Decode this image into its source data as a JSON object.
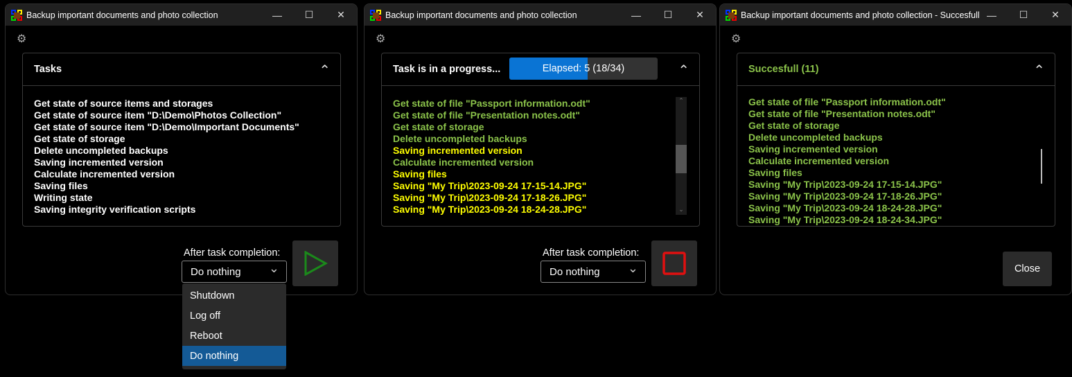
{
  "colors": {
    "pending": "#ffffff",
    "done": "#8bc34a",
    "active": "#ffff00",
    "accent": "#0a74d4",
    "start": "#1b8a1b",
    "stop": "#e01010"
  },
  "windows": [
    {
      "title": "Backup important documents and photo collection",
      "panel_title": "Tasks",
      "panel_title_status": "pending",
      "items": [
        {
          "text": "Get state of source items and storages",
          "status": "pending"
        },
        {
          "text": "Get state of source item \"D:\\Demo\\Photos Collection\"",
          "status": "pending"
        },
        {
          "text": "Get state of source item \"D:\\Demo\\Important Documents\"",
          "status": "pending"
        },
        {
          "text": "Get state of storage",
          "status": "pending"
        },
        {
          "text": "Delete uncompleted backups",
          "status": "pending"
        },
        {
          "text": "Saving incremented version",
          "status": "pending"
        },
        {
          "text": "Calculate incremented version",
          "status": "pending"
        },
        {
          "text": "Saving files",
          "status": "pending"
        },
        {
          "text": "Writing state",
          "status": "pending"
        },
        {
          "text": "Saving integrity verification scripts",
          "status": "pending"
        }
      ],
      "after_label": "After task completion:",
      "after_value": "Do nothing",
      "action": "start-icon",
      "dropdown_options": [
        "Shutdown",
        "Log off",
        "Reboot",
        "Do nothing"
      ],
      "dropdown_selected": "Do nothing"
    },
    {
      "title": "Backup important documents and photo collection",
      "panel_title": "Task is in a progress...",
      "panel_title_status": "pending",
      "progress": {
        "text": "Elapsed: 5 (18/34)",
        "done": 18,
        "total": 34
      },
      "items": [
        {
          "text": "Get state of file \"Passport information.odt\"",
          "status": "done"
        },
        {
          "text": "Get state of file \"Presentation notes.odt\"",
          "status": "done"
        },
        {
          "text": "Get state of storage",
          "status": "done"
        },
        {
          "text": "Delete uncompleted backups",
          "status": "done"
        },
        {
          "text": "Saving incremented version",
          "status": "active"
        },
        {
          "text": "Calculate incremented version",
          "status": "done"
        },
        {
          "text": "Saving files",
          "status": "active"
        },
        {
          "text": "Saving \"My Trip\\2023-09-24 17-15-14.JPG\"",
          "status": "active"
        },
        {
          "text": "Saving \"My Trip\\2023-09-24 17-18-26.JPG\"",
          "status": "active"
        },
        {
          "text": "Saving \"My Trip\\2023-09-24 18-24-28.JPG\"",
          "status": "active"
        }
      ],
      "after_label": "After task completion:",
      "after_value": "Do nothing",
      "action": "stop-icon"
    },
    {
      "title": "Backup important documents and photo collection - Succesfull",
      "panel_title": "Succesfull (11)",
      "panel_title_status": "done",
      "items": [
        {
          "text": "Get state of file \"Passport information.odt\"",
          "status": "done"
        },
        {
          "text": "Get state of file \"Presentation notes.odt\"",
          "status": "done"
        },
        {
          "text": "Get state of storage",
          "status": "done"
        },
        {
          "text": "Delete uncompleted backups",
          "status": "done"
        },
        {
          "text": "Saving incremented version",
          "status": "done"
        },
        {
          "text": "Calculate incremented version",
          "status": "done"
        },
        {
          "text": "Saving files",
          "status": "done"
        },
        {
          "text": "Saving \"My Trip\\2023-09-24 17-15-14.JPG\"",
          "status": "done"
        },
        {
          "text": "Saving \"My Trip\\2023-09-24 17-18-26.JPG\"",
          "status": "done"
        },
        {
          "text": "Saving \"My Trip\\2023-09-24 18-24-28.JPG\"",
          "status": "done"
        },
        {
          "text": "Saving \"My Trip\\2023-09-24 18-24-34.JPG\"",
          "status": "done"
        }
      ],
      "close_label": "Close"
    }
  ]
}
